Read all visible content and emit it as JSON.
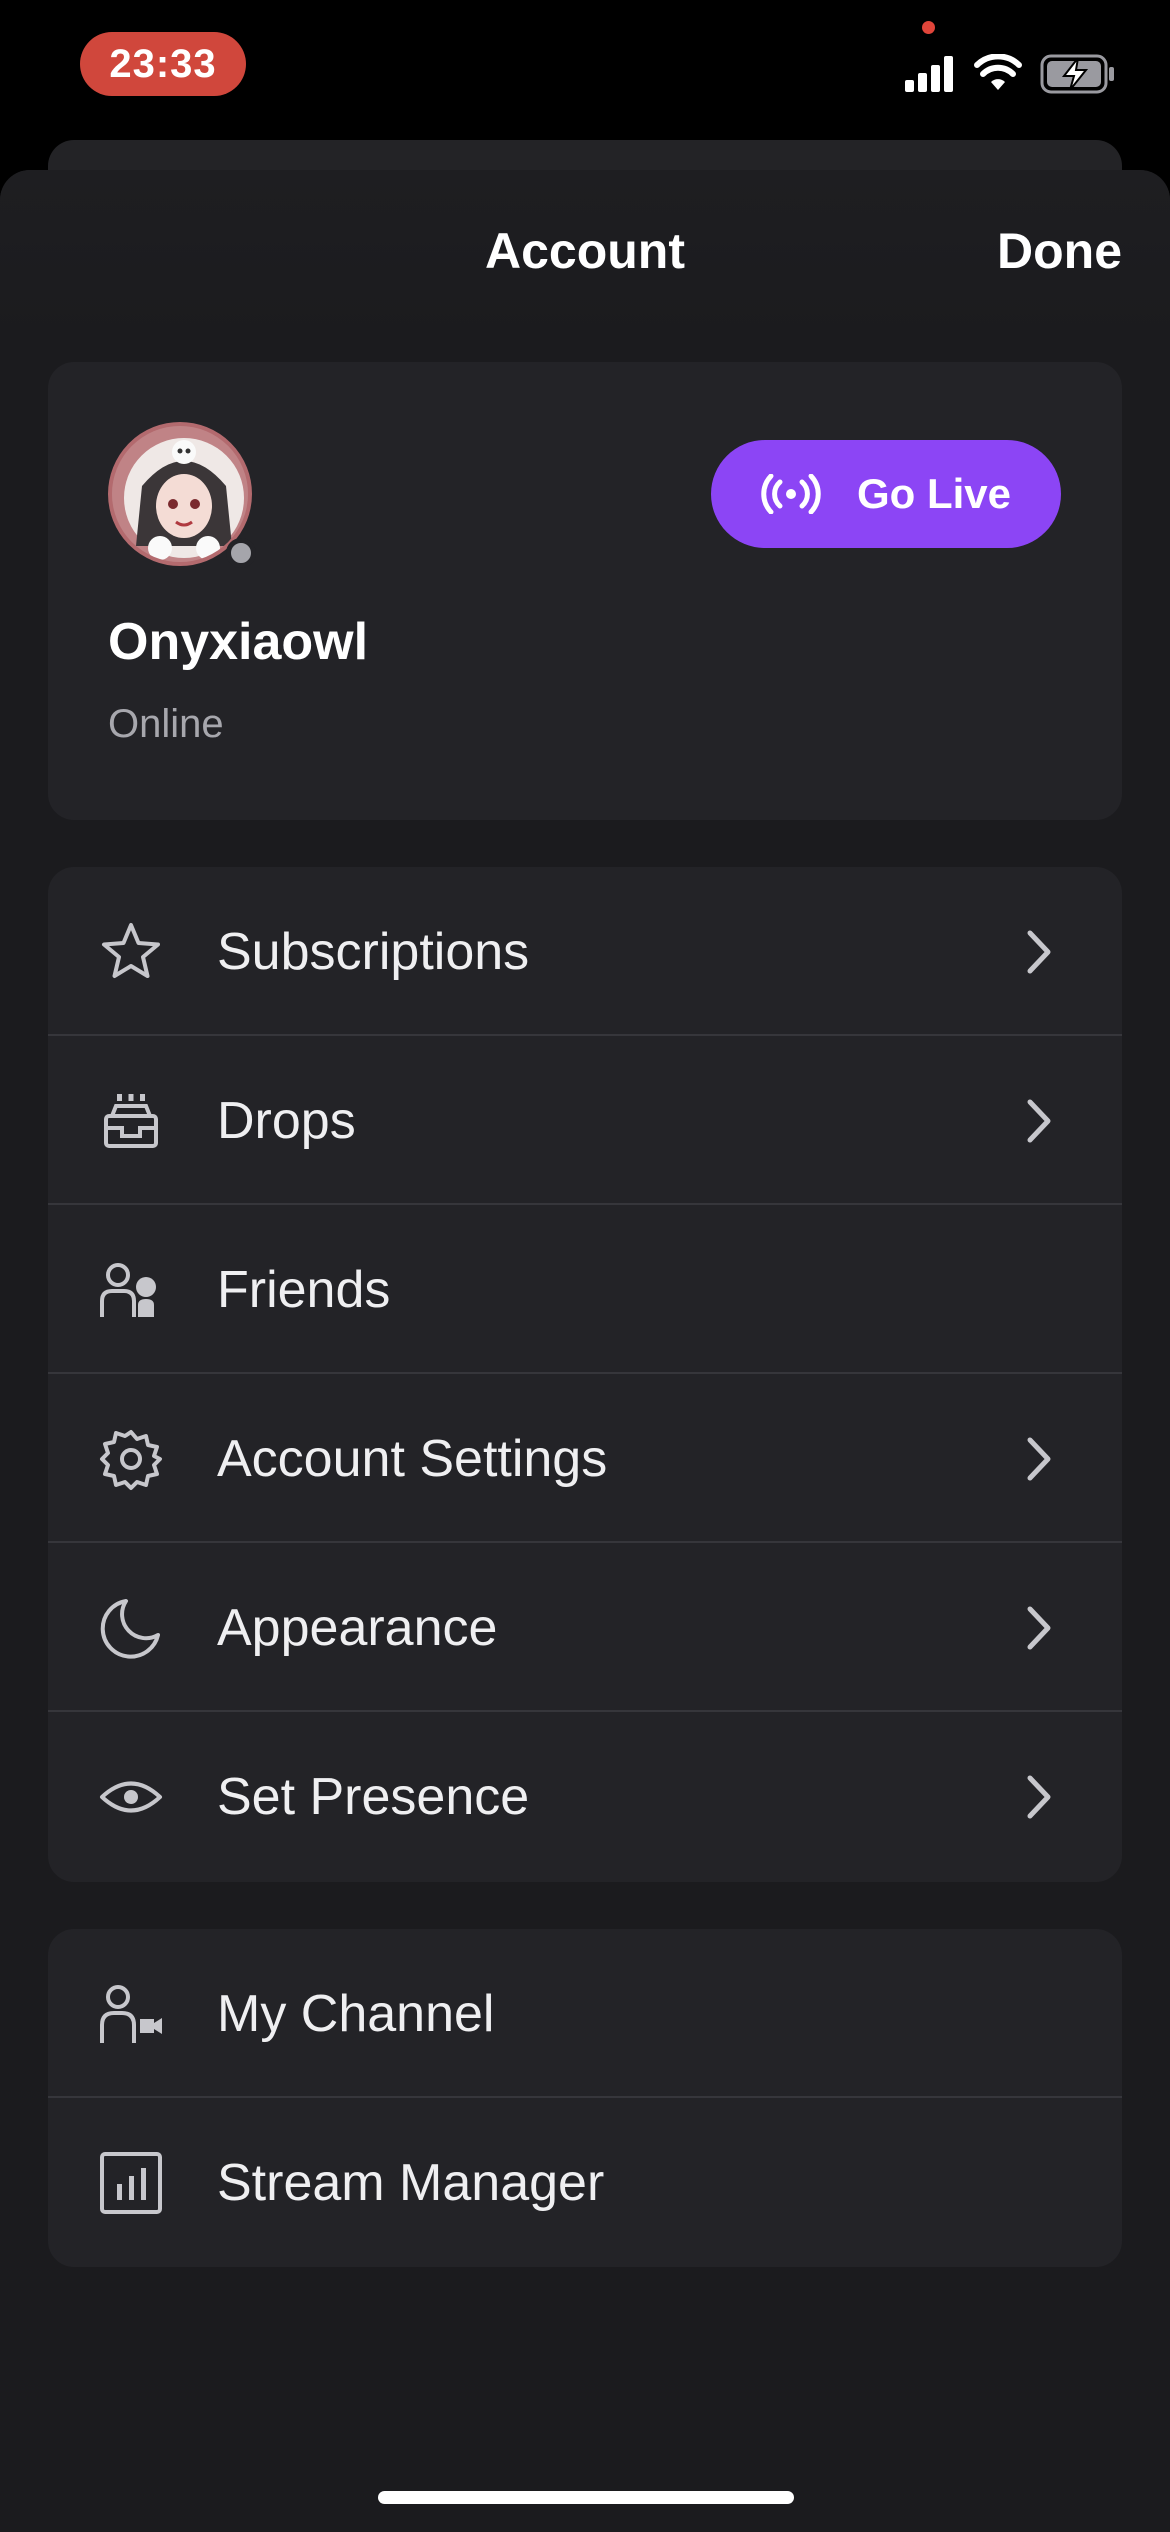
{
  "status_bar": {
    "time": "23:33",
    "icons": [
      "signal-icon",
      "wifi-icon",
      "battery-charging-icon"
    ],
    "recording_indicator_color": "#e0453a",
    "time_pill_color": "#d0473c"
  },
  "header": {
    "title": "Account",
    "done_label": "Done"
  },
  "profile": {
    "username": "Onyxiaowl",
    "status": "Online",
    "go_live_label": "Go Live",
    "go_live_color": "#8c45f5",
    "presence_color": "#a5a5ab"
  },
  "menu_group_1": [
    {
      "label": "Subscriptions",
      "icon": "star-icon",
      "has_chevron": true
    },
    {
      "label": "Drops",
      "icon": "drops-icon",
      "has_chevron": true
    },
    {
      "label": "Friends",
      "icon": "friends-icon",
      "has_chevron": false
    },
    {
      "label": "Account Settings",
      "icon": "gear-icon",
      "has_chevron": true
    },
    {
      "label": "Appearance",
      "icon": "moon-icon",
      "has_chevron": true
    },
    {
      "label": "Set Presence",
      "icon": "eye-icon",
      "has_chevron": true
    }
  ],
  "menu_group_2": [
    {
      "label": "My Channel",
      "icon": "channel-icon",
      "has_chevron": false
    },
    {
      "label": "Stream Manager",
      "icon": "stream-manager-icon",
      "has_chevron": false
    }
  ]
}
